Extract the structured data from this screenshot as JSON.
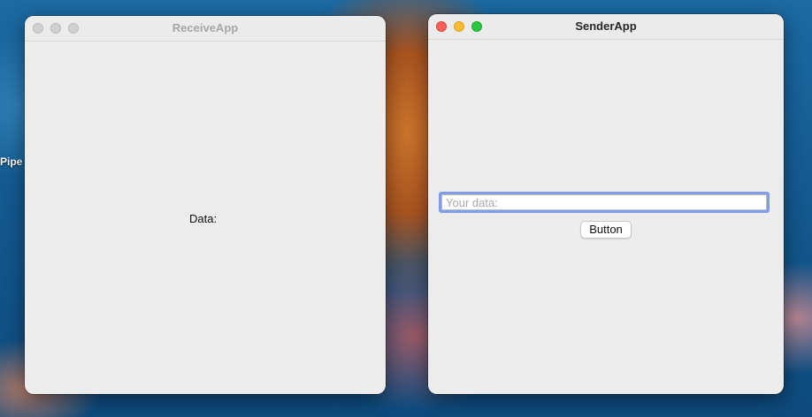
{
  "desktop": {
    "icon_label": "Pipe"
  },
  "receive_window": {
    "title": "ReceiveApp",
    "data_label": "Data:"
  },
  "sender_window": {
    "title": "SenderApp",
    "input_value": "",
    "input_placeholder": "Your data:",
    "button_label": "Button"
  },
  "colors": {
    "focus_ring": "#7f9de8",
    "close": "#fe5f57",
    "minimize": "#febc2e",
    "zoom": "#28c840"
  }
}
